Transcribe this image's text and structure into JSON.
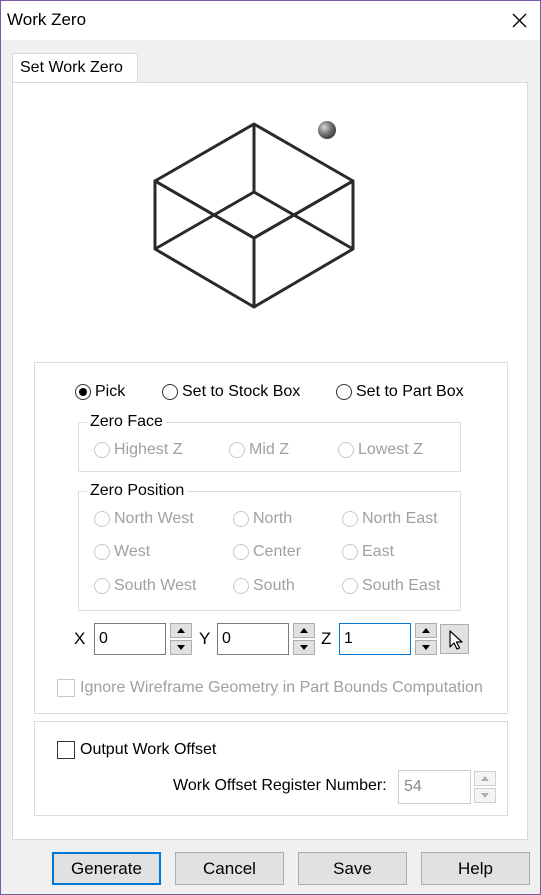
{
  "window": {
    "title": "Work Zero"
  },
  "tab": {
    "label": "Set Work Zero"
  },
  "mode": {
    "options": [
      "Pick",
      "Set to Stock Box",
      "Set to Part Box"
    ],
    "selected": "Pick"
  },
  "zero_face": {
    "legend": "Zero Face",
    "options": [
      "Highest Z",
      "Mid Z",
      "Lowest Z"
    ],
    "enabled": false
  },
  "zero_position": {
    "legend": "Zero Position",
    "rows": [
      [
        "North West",
        "North",
        "North East"
      ],
      [
        "West",
        "Center",
        "East"
      ],
      [
        "South West",
        "South",
        "South East"
      ]
    ],
    "enabled": false
  },
  "coords": {
    "x_label": "X",
    "x_value": "0",
    "y_label": "Y",
    "y_value": "0",
    "z_label": "Z",
    "z_value": "1"
  },
  "ignore_wireframe": {
    "label": "Ignore Wireframe Geometry in Part Bounds Computation",
    "checked": false,
    "enabled": false
  },
  "output_offset": {
    "label": "Output Work Offset",
    "checked": false,
    "register_label": "Work Offset Register Number:",
    "register_value": "54"
  },
  "buttons": {
    "generate": "Generate",
    "cancel": "Cancel",
    "save": "Save",
    "help": "Help"
  },
  "icons": {
    "close": "close-icon",
    "preview": "wireframe-box-icon",
    "pointer": "pointer-arrow-icon",
    "accent": "#0078d7"
  }
}
